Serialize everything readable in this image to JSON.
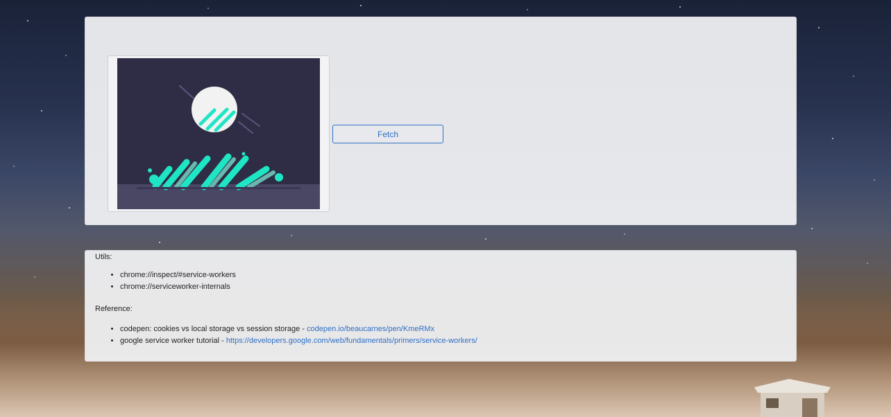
{
  "fetch_panel": {
    "fetch_button_label": "Fetch"
  },
  "info_panel": {
    "utils_title": "Utils:",
    "utils_items": [
      "chrome://inspect/#service-workers",
      "chrome://serviceworker-internals"
    ],
    "reference_title": "Reference:",
    "references": [
      {
        "text": "codepen: cookies vs local storage vs session storage - ",
        "link": "codepen.io/beaucarnes/pen/KmeRMx"
      },
      {
        "text": "google service worker tutorial - ",
        "link": "https://developers.google.com/web/fundamentals/primers/service-workers/"
      }
    ]
  },
  "colors": {
    "accent": "#2d6fc4",
    "illustration_bg": "#2f2c45",
    "illustration_teal": "#1ee6c4"
  }
}
